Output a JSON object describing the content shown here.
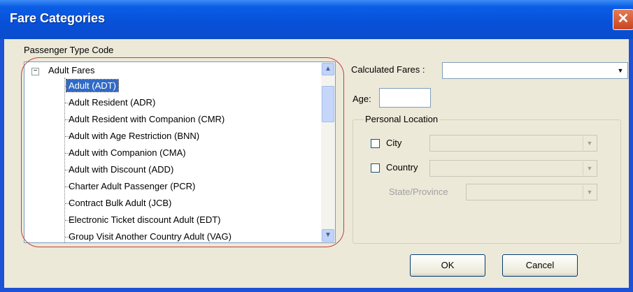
{
  "window": {
    "title": "Fare Categories",
    "close_glyph": "✕"
  },
  "passenger_type": {
    "group_label": "Passenger Type Code",
    "root": {
      "label": "Adult Fares",
      "expander": "−"
    },
    "items": [
      {
        "label": "Adult (ADT)",
        "selected": true
      },
      {
        "label": "Adult Resident (ADR)"
      },
      {
        "label": "Adult Resident with Companion (CMR)"
      },
      {
        "label": "Adult with Age Restriction (BNN)"
      },
      {
        "label": "Adult with Companion (CMA)"
      },
      {
        "label": "Adult with Discount (ADD)"
      },
      {
        "label": "Charter Adult Passenger (PCR)"
      },
      {
        "label": "Contract Bulk Adult (JCB)"
      },
      {
        "label": "Electronic Ticket discount Adult (EDT)"
      },
      {
        "label": "Group Visit Another Country Adult (VAG)"
      }
    ],
    "scroll_up": "▲",
    "scroll_down": "▼"
  },
  "fields": {
    "calculated_fares_label": "Calculated Fares :",
    "calculated_fares_value": "",
    "age_label": "Age:",
    "age_value": ""
  },
  "personal_location": {
    "legend": "Personal Location",
    "city_label": "City",
    "country_label": "Country",
    "state_label": "State/Province",
    "city_checked": false,
    "country_checked": false
  },
  "buttons": {
    "ok": "OK",
    "cancel": "Cancel"
  },
  "dropdown_glyph": "▼",
  "colors": {
    "title_bar": "#0a5de6",
    "selection": "#316ac5",
    "annotation_outline": "#c04040"
  }
}
